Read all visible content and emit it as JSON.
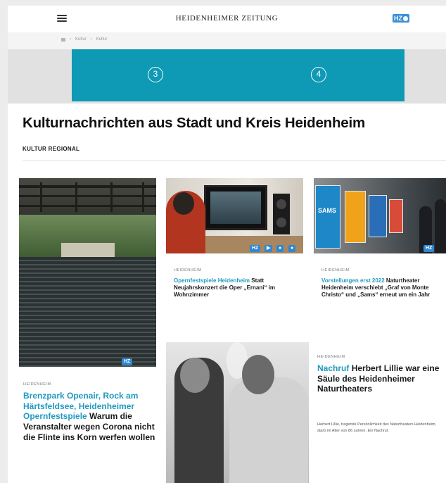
{
  "header": {
    "masthead": "HEIDENHEIMER ZEITUNG",
    "logo": "HZ",
    "menu_icon": "hamburger-icon"
  },
  "breadcrumb": {
    "home_icon": "home-icon",
    "items": [
      "Kultur",
      "Kultur"
    ]
  },
  "ad": {
    "slot_a": "3",
    "slot_b": "4",
    "color": "#0e99b5"
  },
  "page": {
    "title": "Kulturnachrichten aus Stadt und Kreis Heidenheim",
    "section": "KULTUR REGIONAL"
  },
  "articles": [
    {
      "kicker": "HEIDENHEIM",
      "topic": "Brenzpark Openair, Rock am Härtsfeldsee, Heidenheimer Opernfestspiele",
      "title": "Warum die Veranstalter wegen Corona nicht die Flinte ins Korn werfen wollen",
      "badge": "HZ"
    },
    {
      "kicker": "HEIDENHEIM",
      "topic": "Opernfestspiele Heidenheim",
      "title": "Statt Neujahrskonzert die Oper „Ernani“ im Wohnzimmer",
      "badge": "HZ"
    },
    {
      "kicker": "HEIDENHEIM",
      "topic": "Vorstellungen erst 2022",
      "title": "Naturtheater Heidenheim verschiebt „Graf von Monte Christo“ und „Sams“ erneut um ein Jahr",
      "badge": "HZ",
      "poster_text": "SAMS"
    },
    {
      "kicker": "HEIDENHEIM",
      "topic": "Nachruf",
      "title": "Herbert Lillie war eine Säule des Heidenheimer Naturtheaters",
      "teaser": "Herbert Lillie, tragende Persönlichkeit des Naturtheaters Heidenheim, starb im Alter von 86 Jahren. Ein Nachruf."
    }
  ],
  "colors": {
    "accent": "#1f9abf",
    "badge": "#2f88d0"
  }
}
